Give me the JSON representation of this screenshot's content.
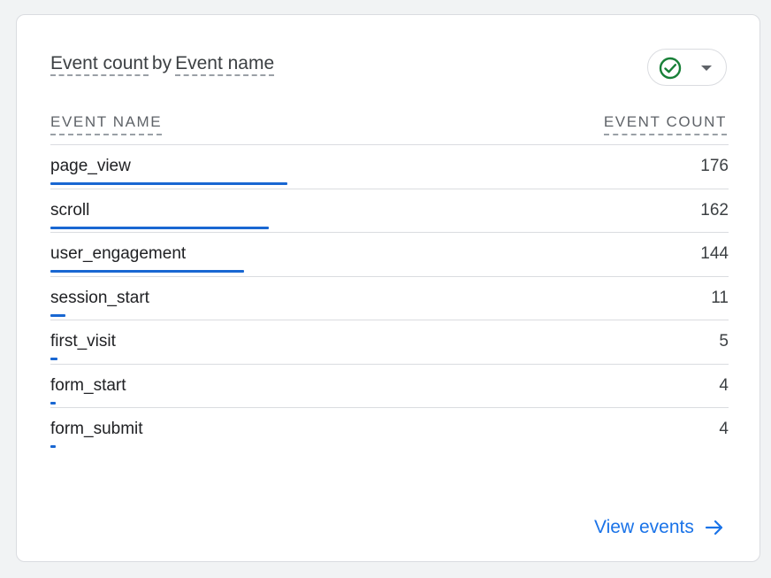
{
  "card": {
    "title_metric": "Event count",
    "title_by": "by",
    "title_dimension": "Event name",
    "status_icon": "check-circle-icon",
    "status_color": "#188038"
  },
  "table": {
    "col_name": "EVENT NAME",
    "col_count": "EVENT COUNT",
    "bar_color": "#1967d2",
    "rows": [
      {
        "name": "page_view",
        "count": "176",
        "value": 176
      },
      {
        "name": "scroll",
        "count": "162",
        "value": 162
      },
      {
        "name": "user_engagement",
        "count": "144",
        "value": 144
      },
      {
        "name": "session_start",
        "count": "11",
        "value": 11
      },
      {
        "name": "first_visit",
        "count": "5",
        "value": 5
      },
      {
        "name": "form_start",
        "count": "4",
        "value": 4
      },
      {
        "name": "form_submit",
        "count": "4",
        "value": 4
      }
    ]
  },
  "footer": {
    "view_events_label": "View events",
    "link_color": "#1a73e8"
  }
}
